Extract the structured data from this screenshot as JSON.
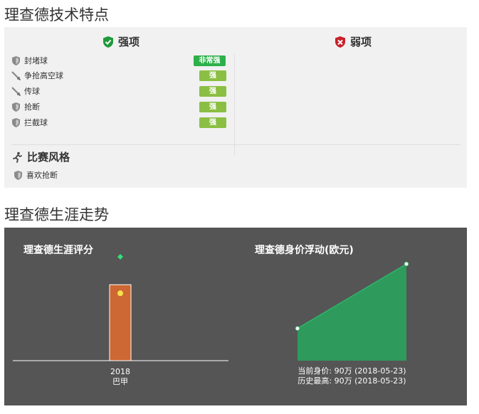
{
  "titles": {
    "tech": "理查德技术特点",
    "career": "理查德生涯走势"
  },
  "strengths": {
    "heading": "强项",
    "items": [
      {
        "label": "封堵球",
        "level": "非常强",
        "icon": "shield-icon"
      },
      {
        "label": "争抢高空球",
        "level": "强",
        "icon": "sword-icon"
      },
      {
        "label": "传球",
        "level": "强",
        "icon": "sword-icon"
      },
      {
        "label": "抢断",
        "level": "强",
        "icon": "shield-icon"
      },
      {
        "label": "拦截球",
        "level": "强",
        "icon": "shield-icon"
      }
    ]
  },
  "weaknesses": {
    "heading": "弱项"
  },
  "style": {
    "heading": "比赛风格",
    "items": [
      {
        "label": "喜欢抢断",
        "icon": "shield-icon"
      }
    ]
  },
  "colors": {
    "very_strong": "#2db04a",
    "strong": "#8bbf43",
    "strength_icon": "#1f9a3a",
    "weakness_icon": "#c9202b",
    "panel_bg": "#f1f1f1",
    "chart_bg": "#555555",
    "bar": "#cd6733",
    "value_area": "#2e9a5c"
  },
  "chart_data": [
    {
      "type": "bar",
      "title": "理查德生涯评分",
      "categories": [
        "2018"
      ],
      "sublabels": [
        "巴甲"
      ],
      "values": [
        6.8
      ],
      "markers": [
        6.8
      ],
      "peak_marker": 9.3,
      "ylim": [
        0,
        10
      ]
    },
    {
      "type": "area",
      "title": "理查德身价浮动(欧元)",
      "series": [
        {
          "values": [
            30,
            90
          ]
        }
      ],
      "ylim": [
        0,
        100
      ],
      "notes": [
        "当前身价: 90万 (2018-05-23)",
        "历史最高: 90万 (2018-05-23)"
      ]
    }
  ]
}
